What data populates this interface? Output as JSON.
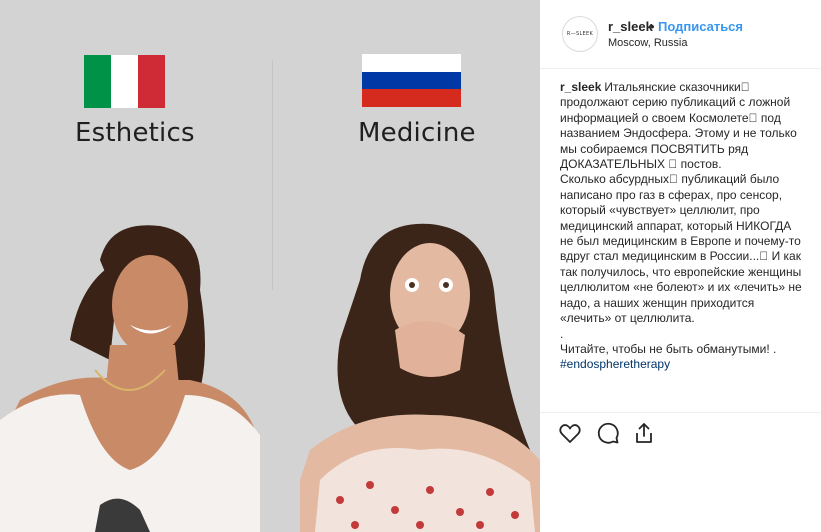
{
  "media": {
    "left_caption": "Esthetics",
    "right_caption": "Medicine",
    "left_flag": "italy-flag",
    "right_flag": "russia-flag"
  },
  "post": {
    "avatar_text": "R—SLEEK",
    "username": "r_sleek",
    "separator": "•",
    "follow_label": "Подписаться",
    "location": "Moscow, Russia"
  },
  "caption": {
    "username": "r_sleek",
    "paragraph1": "Итальянские сказочники⃞ продолжают серию публикаций с ложной информацией о своем Космолете⃞ под названием Эндосфера. Этому и не только мы собираемся ПОСВЯТИТЬ ряд ДОКАЗАТЕЛЬНЫХ ⃞ постов.",
    "paragraph2": "Сколько абсурдных⃞ публикаций было написано про газ в сферах, про сенсор, который «чувствует» целлюлит, про медицинский аппарат, который НИКОГДА ⃞не был медицинским в Европе и почему-то вдруг стал медицинским в России...⃞ И как так получилось, что европейские женщины целлюлитом «не болеют» и их «лечить» не надо, а наших женщин приходится «лечить» от целлюлита.",
    "dot_line": ".",
    "paragraph3": "Читайте, чтобы не быть обманутыми! .",
    "hashtag": "#endospheretherapy"
  },
  "actions": {
    "like_icon": "heart-icon",
    "comment_icon": "comment-icon",
    "share_icon": "share-icon"
  },
  "colors": {
    "accent": "#3897f0",
    "italy_green": "#009246",
    "italy_white": "#ffffff",
    "italy_red": "#ce2b37",
    "russia_white": "#ffffff",
    "russia_blue": "#0039a6",
    "russia_red": "#d52b1e"
  }
}
